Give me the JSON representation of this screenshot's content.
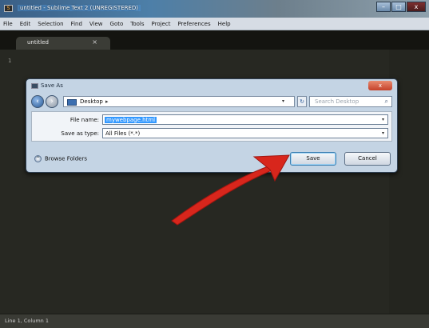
{
  "window": {
    "title": "untitled - Sublime Text 2 (UNREGISTERED)",
    "controls": {
      "minimize": "–",
      "maximize": "□",
      "close": "x"
    }
  },
  "menu": [
    "File",
    "Edit",
    "Selection",
    "Find",
    "View",
    "Goto",
    "Tools",
    "Project",
    "Preferences",
    "Help"
  ],
  "tab": {
    "label": "untitled",
    "close": "×"
  },
  "editor": {
    "line_number": "1"
  },
  "status": {
    "text": "Line 1, Column 1"
  },
  "dialog": {
    "title": "Save As",
    "close": "x",
    "address": {
      "location": "Desktop",
      "separator": "▸",
      "dropdown": "▾"
    },
    "refresh": "↻",
    "search_placeholder": "Search Desktop",
    "file_name_label": "File name:",
    "file_name_value": "mywebpage.html",
    "save_type_label": "Save as type:",
    "save_type_value": "All Files (*.*)",
    "browse_label": "Browse Folders",
    "save_button": "Save",
    "cancel_button": "Cancel"
  },
  "colors": {
    "editor_bg": "#272822",
    "dialog_bg": "#c4d4e4",
    "arrow": "#d8261c",
    "selection": "#3399ff"
  }
}
